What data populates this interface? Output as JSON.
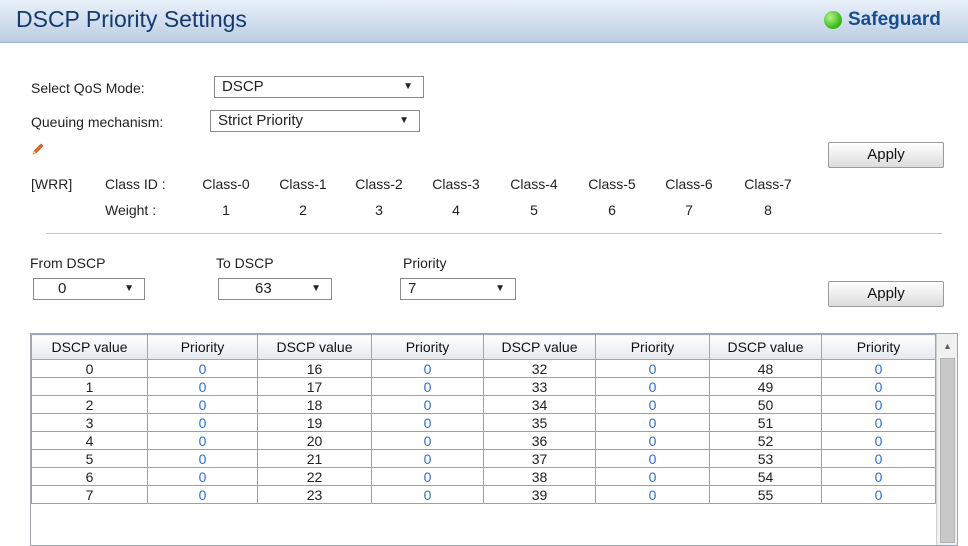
{
  "header": {
    "title": "DSCP Priority Settings",
    "safeguard_label": "Safeguard",
    "safeguard_color": "#3fbf20"
  },
  "qos": {
    "mode_label": "Select QoS Mode:",
    "mode_value": "DSCP",
    "queuing_label": "Queuing mechanism:",
    "queuing_value": "Strict Priority",
    "apply_label": "Apply"
  },
  "wrr": {
    "tag": "[WRR]",
    "class_id_label": "Class ID :",
    "weight_label": "Weight  :",
    "classes": [
      "Class-0",
      "Class-1",
      "Class-2",
      "Class-3",
      "Class-4",
      "Class-5",
      "Class-6",
      "Class-7"
    ],
    "weights": [
      "1",
      "2",
      "3",
      "4",
      "5",
      "6",
      "7",
      "8"
    ]
  },
  "mapping": {
    "from_label": "From DSCP",
    "from_value": "0",
    "to_label": "To DSCP",
    "to_value": "63",
    "priority_label": "Priority",
    "priority_value": "7",
    "apply_label": "Apply"
  },
  "table": {
    "headers": [
      "DSCP value",
      "Priority",
      "DSCP value",
      "Priority",
      "DSCP value",
      "Priority",
      "DSCP value",
      "Priority"
    ],
    "rows": [
      [
        "0",
        "0",
        "16",
        "0",
        "32",
        "0",
        "48",
        "0"
      ],
      [
        "1",
        "0",
        "17",
        "0",
        "33",
        "0",
        "49",
        "0"
      ],
      [
        "2",
        "0",
        "18",
        "0",
        "34",
        "0",
        "50",
        "0"
      ],
      [
        "3",
        "0",
        "19",
        "0",
        "35",
        "0",
        "51",
        "0"
      ],
      [
        "4",
        "0",
        "20",
        "0",
        "36",
        "0",
        "52",
        "0"
      ],
      [
        "5",
        "0",
        "21",
        "0",
        "37",
        "0",
        "53",
        "0"
      ],
      [
        "6",
        "0",
        "22",
        "0",
        "38",
        "0",
        "54",
        "0"
      ],
      [
        "7",
        "0",
        "23",
        "0",
        "39",
        "0",
        "55",
        "0"
      ]
    ]
  }
}
